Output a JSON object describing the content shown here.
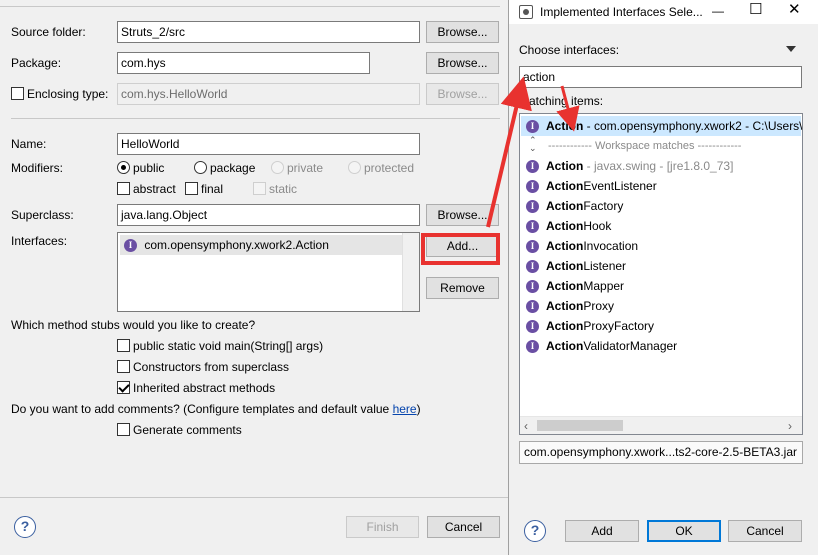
{
  "wizard": {
    "source_folder": {
      "label": "Source folder:",
      "value": "Struts_2/src",
      "browse": "Browse..."
    },
    "package": {
      "label": "Package:",
      "value": "com.hys",
      "browse": "Browse..."
    },
    "enclosing": {
      "label": "Enclosing type:",
      "value": "com.hys.HelloWorld",
      "browse": "Browse..."
    },
    "name": {
      "label": "Name:",
      "value": "HelloWorld"
    },
    "modifiers": {
      "label": "Modifiers:",
      "options": [
        "public",
        "package",
        "private",
        "protected"
      ],
      "extra": [
        "abstract",
        "final",
        "static"
      ]
    },
    "superclass": {
      "label": "Superclass:",
      "value": "java.lang.Object",
      "browse": "Browse..."
    },
    "interfaces": {
      "label": "Interfaces:",
      "items": [
        "com.opensymphony.xwork2.Action"
      ],
      "add": "Add...",
      "remove": "Remove"
    },
    "stubs": {
      "question": "Which method stubs would you like to create?",
      "main": "public static void main(String[] args)",
      "constructors": "Constructors from superclass",
      "inherited": "Inherited abstract methods"
    },
    "comments": {
      "question": "Do you want to add comments? (Configure templates and default value ",
      "link": "here",
      "close_paren": ")",
      "generate": "Generate comments"
    },
    "buttons": {
      "help": "?",
      "finish": "Finish",
      "cancel": "Cancel"
    }
  },
  "dialog": {
    "title": "Implemented Interfaces Sele...",
    "controls": {
      "minimize": "—",
      "maximize": "☐",
      "close": "✕"
    },
    "choose_label": "Choose interfaces:",
    "search_value": "action",
    "matching_label": "Matching items:",
    "items": [
      {
        "bold": "Action",
        "rest": " - com.opensymphony.xwork2 - C:\\Users\\",
        "selected": true
      },
      {
        "separator": "------------ Workspace matches ------------"
      },
      {
        "bold": "Action",
        "rest": " - javax.swing - [jre1.8.0_73]",
        "grey_rest": true
      },
      {
        "bold": "Action",
        "rest": "EventListener"
      },
      {
        "bold": "Action",
        "rest": "Factory"
      },
      {
        "bold": "Action",
        "rest": "Hook"
      },
      {
        "bold": "Action",
        "rest": "Invocation"
      },
      {
        "bold": "Action",
        "rest": "Listener"
      },
      {
        "bold": "Action",
        "rest": "Mapper"
      },
      {
        "bold": "Action",
        "rest": "Proxy"
      },
      {
        "bold": "Action",
        "rest": "ProxyFactory"
      },
      {
        "bold": "Action",
        "rest": "ValidatorManager"
      }
    ],
    "location": "com.opensymphony.xwork...ts2-core-2.5-BETA3.jar",
    "buttons": {
      "help": "?",
      "add": "Add",
      "ok": "OK",
      "cancel": "Cancel"
    }
  },
  "colors": {
    "annotation": "#e8322f",
    "selection": "#cce8ff",
    "link": "#0645ad"
  }
}
